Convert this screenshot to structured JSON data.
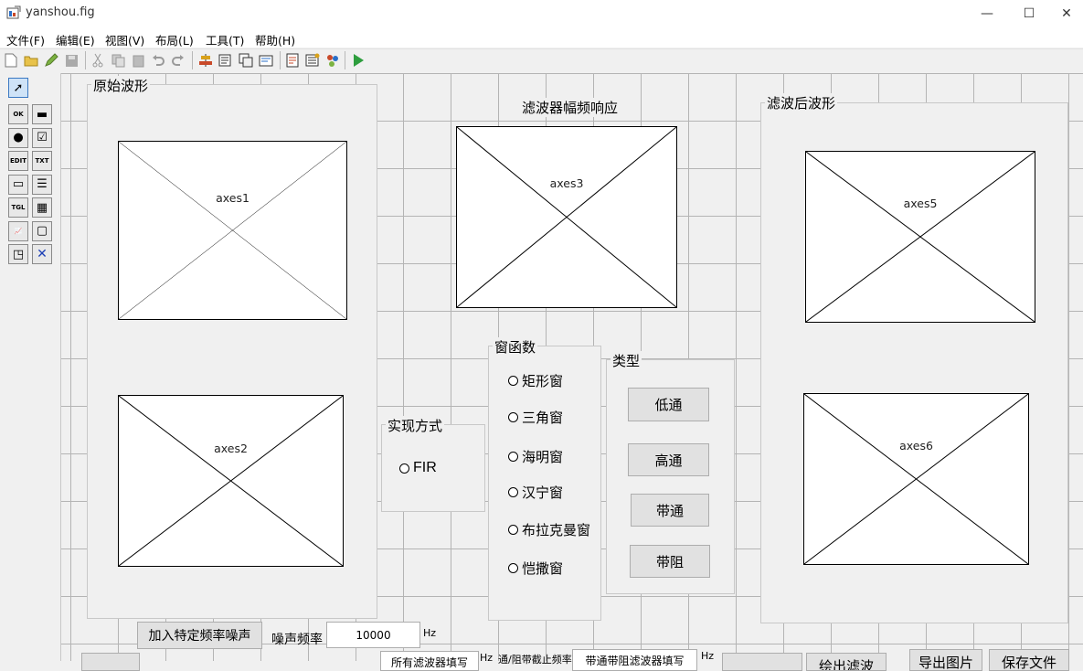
{
  "window": {
    "title": "yanshou.fig",
    "minimize": "—",
    "maximize": "☐",
    "close": "✕"
  },
  "menu": [
    "文件(F)",
    "编辑(E)",
    "视图(V)",
    "布局(L)",
    "工具(T)",
    "帮助(H)"
  ],
  "toolbar_icons": [
    "new-file-icon",
    "open-folder-icon",
    "edit-icon",
    "save-icon",
    "cut-icon",
    "copy-icon",
    "paste-icon",
    "undo-icon",
    "redo-icon",
    "align-icon",
    "editor-icon",
    "tab-order-icon",
    "menu-editor-icon",
    "m-file-icon",
    "property-inspector-icon",
    "object-browser-icon",
    "run-icon"
  ],
  "palette": [
    {
      "name": "select-tool",
      "glyph": "➚"
    },
    {
      "name": "pushbutton-tool",
      "glyph": "OK"
    },
    {
      "name": "slider-tool",
      "glyph": "▬"
    },
    {
      "name": "radiobutton-tool",
      "glyph": "●"
    },
    {
      "name": "checkbox-tool",
      "glyph": "☑"
    },
    {
      "name": "edit-text-tool",
      "glyph": "EDIT"
    },
    {
      "name": "static-text-tool",
      "glyph": "TXT"
    },
    {
      "name": "popup-menu-tool",
      "glyph": "▭"
    },
    {
      "name": "listbox-tool",
      "glyph": "☰"
    },
    {
      "name": "toggle-button-tool",
      "glyph": "TGL"
    },
    {
      "name": "table-tool",
      "glyph": "▦"
    },
    {
      "name": "axes-tool",
      "glyph": "📈"
    },
    {
      "name": "panel-tool",
      "glyph": "▢"
    },
    {
      "name": "button-group-tool",
      "glyph": "◳"
    },
    {
      "name": "activex-tool",
      "glyph": "✕"
    }
  ],
  "panels": {
    "original": {
      "title": "原始波形",
      "axes": [
        "axes1",
        "axes2"
      ]
    },
    "response": {
      "title": "滤波器幅频响应",
      "axes": [
        "axes3"
      ]
    },
    "filtered": {
      "title": "滤波后波形",
      "axes": [
        "axes5",
        "axes6"
      ]
    },
    "method": {
      "title": "实现方式",
      "options": [
        "FIR"
      ]
    },
    "window_fn": {
      "title": "窗函数",
      "options": [
        "矩形窗",
        "三角窗",
        "海明窗",
        "汉宁窗",
        "布拉克曼窗",
        "恺撒窗"
      ]
    },
    "type": {
      "title": "类型",
      "buttons": [
        "低通",
        "高通",
        "带通",
        "带阻"
      ]
    }
  },
  "bottom": {
    "add_noise_button": "加入特定频率噪声",
    "noise_freq_label": "噪声频率",
    "noise_freq_value": "10000",
    "hz1": "Hz",
    "field_left_partial": "所有滤波器填写",
    "hz2": "Hz",
    "cutoff_label": "通/阻带截止频率",
    "field_right_partial": "带通带阻滤波器填写",
    "hz3": "Hz",
    "btn_partial_1": "",
    "btn_partial_2": "绘出滤波",
    "btn_partial_3": "导出图片",
    "btn_partial_4": "保存文件"
  }
}
